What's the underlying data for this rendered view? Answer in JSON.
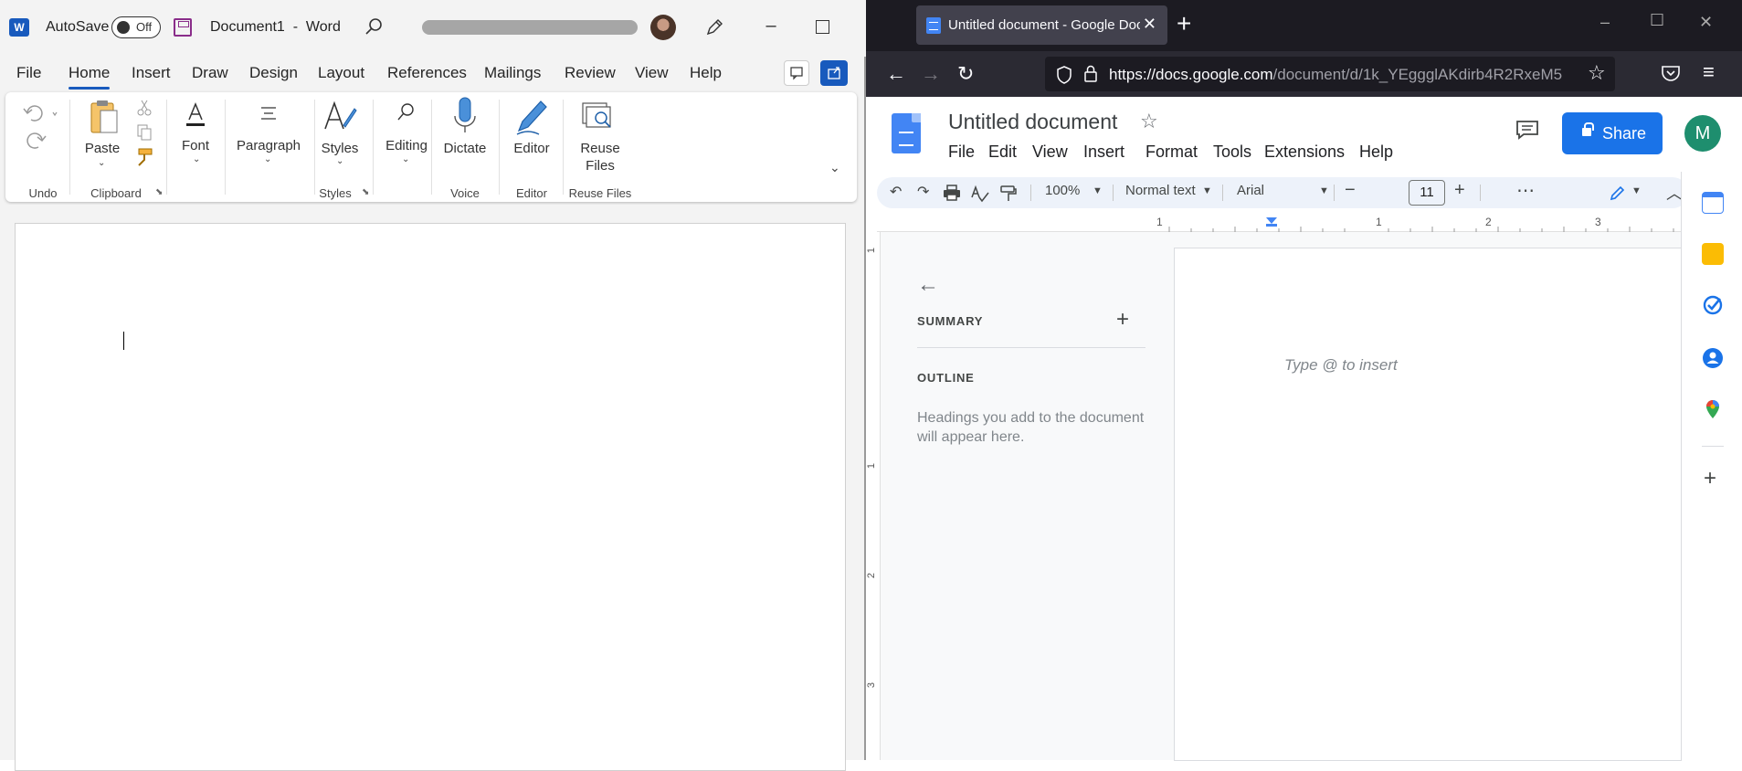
{
  "word": {
    "app_logo": "W",
    "autosave_label": "AutoSave",
    "autosave_state": "Off",
    "doc_title": "Document1  -  Word",
    "menu": [
      "File",
      "Home",
      "Insert",
      "Draw",
      "Design",
      "Layout",
      "References",
      "Mailings",
      "Review",
      "View",
      "Help"
    ],
    "active_tab": "Home",
    "ribbon": {
      "paste": "Paste",
      "font": "Font",
      "paragraph": "Paragraph",
      "styles": "Styles",
      "editing": "Editing",
      "dictate": "Dictate",
      "editor": "Editor",
      "reuse_files": "Reuse Files",
      "groups": {
        "undo": "Undo",
        "clipboard": "Clipboard",
        "styles": "Styles",
        "voice": "Voice",
        "editor": "Editor",
        "reuse_files": "Reuse Files"
      }
    },
    "colors": {
      "accent": "#185abd",
      "save_icon": "#8a2d8a"
    }
  },
  "browser": {
    "tab_title": "Untitled document - Google Docs",
    "url_host": "https://docs.google.com",
    "url_path": "/document/d/1k_YEggglAKdirb4R2RxeM5",
    "new_tab": "+",
    "tab_close": "✕"
  },
  "docs": {
    "title": "Untitled document",
    "menu": [
      "File",
      "Edit",
      "View",
      "Insert",
      "Format",
      "Tools",
      "Extensions",
      "Help"
    ],
    "share_label": "Share",
    "avatar_letter": "M",
    "toolbar": {
      "zoom": "100%",
      "style": "Normal text",
      "font": "Arial",
      "font_size": "11"
    },
    "ruler_numbers": [
      "1",
      "1",
      "2",
      "3"
    ],
    "vruler_numbers": [
      "1",
      "1",
      "2",
      "3"
    ],
    "outline": {
      "summary_label": "SUMMARY",
      "outline_label": "OUTLINE",
      "hint": "Headings you add to the document will appear here."
    },
    "page_placeholder": "Type @ to insert",
    "colors": {
      "share": "#1a73e8",
      "avatar": "#1e8e6e",
      "toolbar_bg": "#edf2fa"
    }
  }
}
